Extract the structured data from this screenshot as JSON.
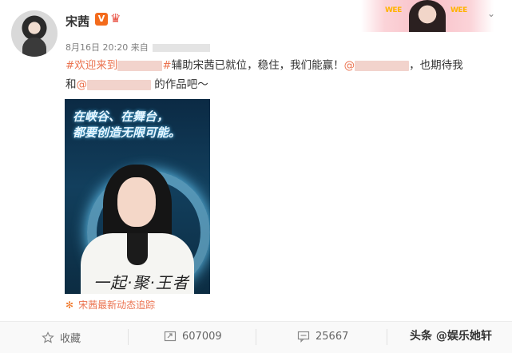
{
  "post": {
    "username": "宋茜",
    "verified_badge": "V",
    "timestamp": "8月16日 20:20",
    "source_prefix": "来自",
    "text_topic_start": "#欢迎来到",
    "text_topic_end": "#",
    "text_main": "辅助宋茜已就位，稳住，我们能赢！",
    "text_mention1_prefix": "@",
    "text_after_mention1": "，也期待我",
    "text_line2_prefix": "和",
    "text_mention2_prefix": "@",
    "text_line2_suffix": "的作品吧～",
    "image_slogan_line1": "在峡谷、在舞台，",
    "image_slogan_line2": "都要创造无限可能。",
    "image_signature": "一起·聚·王者",
    "tracker_label": "宋茜最新动态追踪"
  },
  "actions": {
    "favorite_label": "收藏",
    "repost_count": "607009",
    "comment_count": "25667"
  },
  "watermark": "头条 @娱乐她轩",
  "banner": {
    "tag_left": "WEE",
    "tag_right": "WEE"
  },
  "colors": {
    "link": "#eb7350",
    "verified": "#f36b1c",
    "banner_pink": "#f9c0c8"
  }
}
